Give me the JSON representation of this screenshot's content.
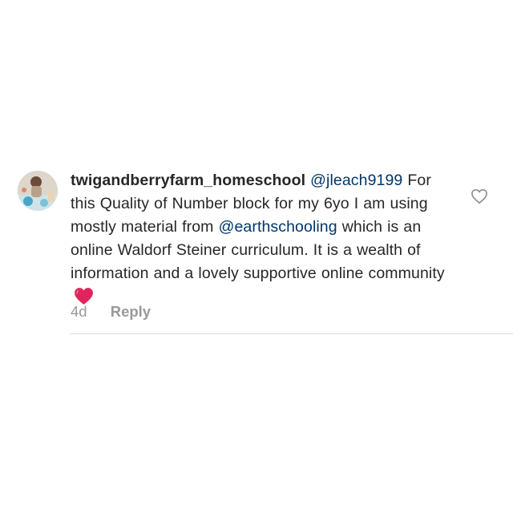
{
  "comment": {
    "avatar_icon": "profile-photo-avatar",
    "username": "twigandberryfarm_homeschool",
    "mention_user": "@jleach9199",
    "text_part1": "For this Quality of Number block for my 6yo I am using mostly material from",
    "mention_source": "@earthschooling",
    "text_part2": "which is an online Waldorf Steiner curriculum. It is a wealth of information and a lovely supportive online community",
    "emoji_icon": "red-heart-icon",
    "emoji_color": "#e0245e",
    "time_ago": "4d",
    "reply_label": "Reply",
    "like_icon": "heart-outline-icon"
  },
  "colors": {
    "text": "#262626",
    "mention": "#003569",
    "meta": "#999999",
    "divider": "#dbdbdb"
  }
}
